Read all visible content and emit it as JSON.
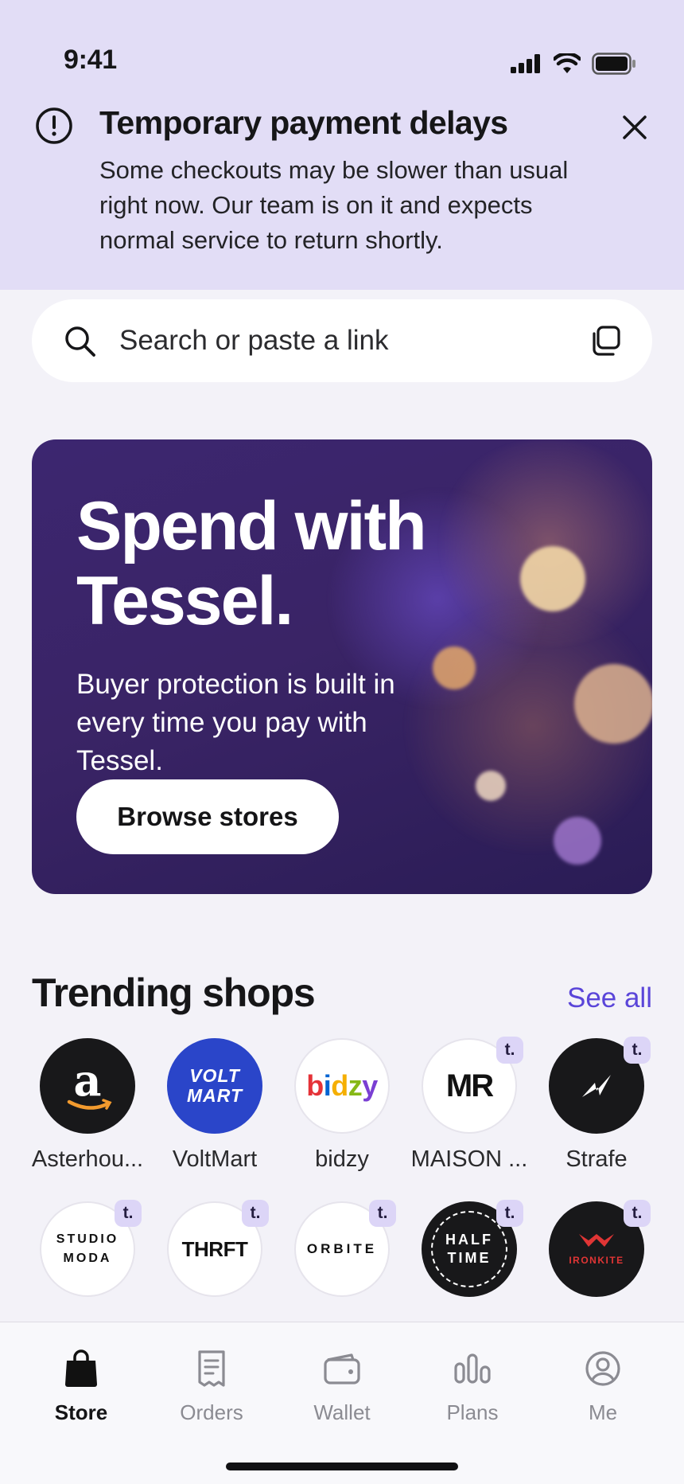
{
  "status_bar": {
    "time": "9:41"
  },
  "alert": {
    "icon": "exclamation-circle-icon",
    "title": "Temporary payment delays",
    "body": "Some checkouts may be slower than usual right now. Our team is on it and expects normal service to return shortly."
  },
  "search": {
    "placeholder": "Search or paste a link"
  },
  "hero": {
    "title": "Spend with Tessel.",
    "text": "Buyer protection is built in every time you pay with Tessel.",
    "button_label": "Browse stores"
  },
  "trending": {
    "title": "Trending shops",
    "see_all_label": "See all",
    "badge_label": "t.",
    "row1": [
      {
        "name": "Asterhou...",
        "logo_text": "a"
      },
      {
        "name": "VoltMart",
        "logo_text": "VOLT MART"
      },
      {
        "name": "bidzy",
        "logo_text": "bidzy"
      },
      {
        "name": "MAISON ...",
        "logo_text": "MR"
      },
      {
        "name": "Strafe",
        "logo_text": ""
      }
    ],
    "row2": [
      {
        "logo_text": "STUDIO MODA"
      },
      {
        "logo_text": "THRFT"
      },
      {
        "logo_text": "ORBITE"
      },
      {
        "logo_text": "HALF TIME"
      },
      {
        "logo_text": "IRONKITE"
      }
    ]
  },
  "tabs": [
    {
      "label": "Store",
      "icon": "bag-icon",
      "active": true
    },
    {
      "label": "Orders",
      "icon": "receipt-icon"
    },
    {
      "label": "Wallet",
      "icon": "wallet-icon"
    },
    {
      "label": "Plans",
      "icon": "plans-chart-icon"
    },
    {
      "label": "Me",
      "icon": "profile-icon"
    }
  ],
  "colors": {
    "banner": "#e2ddf6",
    "accent": "#5a45d9",
    "hero": "#3a2466",
    "voltmart": "#2a45c9"
  }
}
